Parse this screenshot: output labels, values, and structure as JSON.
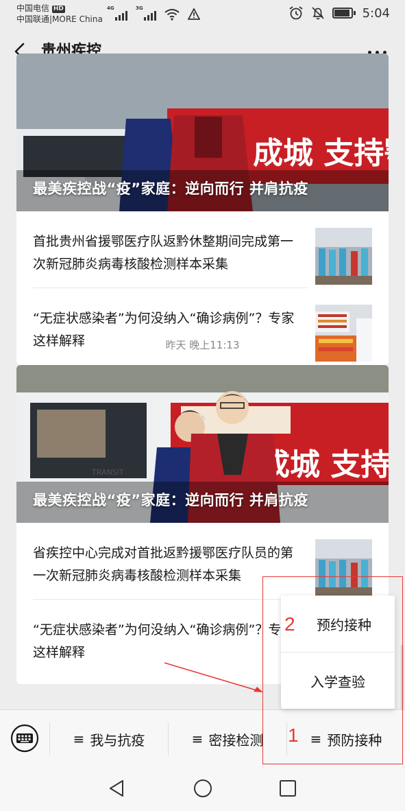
{
  "status_bar": {
    "carrier_1": "中国电信",
    "hd_badge": "HD",
    "carrier_2": "中国联通|MORE China",
    "signal_1_type": "4G",
    "signal_2_type": "3G",
    "time": "5:04"
  },
  "header": {
    "title": "贵州疾控",
    "back_icon": "chevron-left-icon",
    "more_icon": "more-dots-icon"
  },
  "article_groups": [
    {
      "hero_title": "最美疾控战“疫”家庭：逆向而行 并肩抗疫",
      "items": [
        {
          "title": "首批贵州省援鄂医疗队返黔休整期间完成第一次新冠肺炎病毒核酸检测样本采集"
        },
        {
          "title": "“无症状感染者”为何没纳入“确诊病例”？专家这样解释"
        }
      ]
    },
    {
      "hero_title": "最美疾控战“疫”家庭：逆向而行 并肩抗疫",
      "items": [
        {
          "title": "省疾控中心完成对首批返黔援鄂医疗队员的第一次新冠肺炎病毒核酸检测样本采集"
        },
        {
          "title": "“无症状感染者”为何没纳入“确诊病例”？专家这样解释"
        }
      ]
    }
  ],
  "date_separator": "昨天 晚上11:13",
  "bottom_menu": {
    "keyboard_icon": "keyboard-icon",
    "items": [
      {
        "label": "我与抗疫"
      },
      {
        "label": "密接检测"
      },
      {
        "label": "预防接种"
      }
    ],
    "hamburger": "≡"
  },
  "submenu": {
    "items": [
      {
        "label": "预约接种"
      },
      {
        "label": "入学查验"
      }
    ]
  },
  "annotations": {
    "label_1": "1",
    "label_2": "2",
    "color": "#e53935"
  },
  "nav_bar": {
    "back_icon": "triangle-back-icon",
    "home_icon": "circle-home-icon",
    "recent_icon": "square-recent-icon"
  }
}
